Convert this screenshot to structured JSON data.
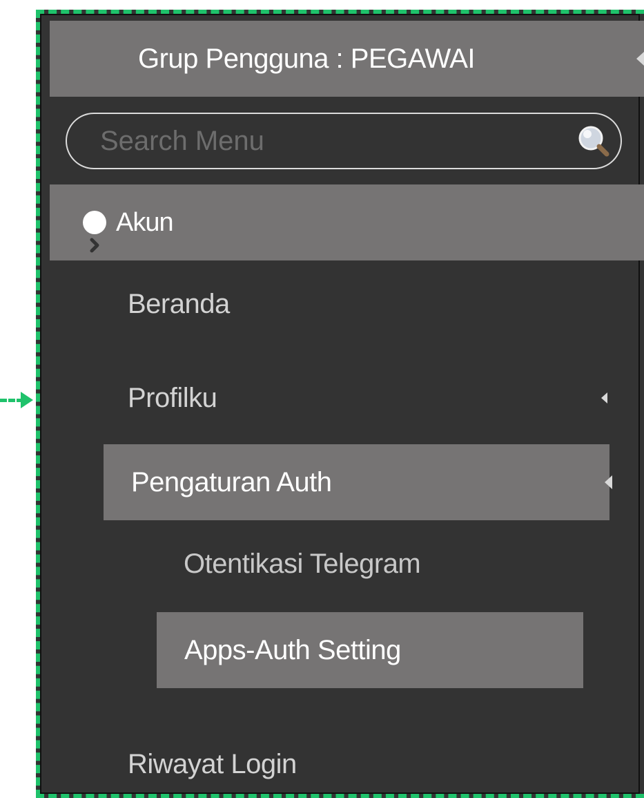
{
  "sidebar": {
    "group_label": "Grup Pengguna : PEGAWAI",
    "search": {
      "placeholder": "Search Menu",
      "value": ""
    },
    "section": {
      "label": "Akun",
      "icon": "chevron-right-circle-icon"
    },
    "items": [
      {
        "label": "Beranda"
      },
      {
        "label": "Profilku"
      },
      {
        "label": "Pengaturan Auth"
      },
      {
        "label": "Riwayat Login"
      }
    ],
    "auth_submenu": [
      {
        "label": "Otentikasi Telegram"
      },
      {
        "label": "Apps-Auth Setting"
      }
    ]
  },
  "colors": {
    "sidebar_bg": "#333333",
    "highlight_bg": "#767474",
    "frame_accent": "#1fc26b"
  }
}
